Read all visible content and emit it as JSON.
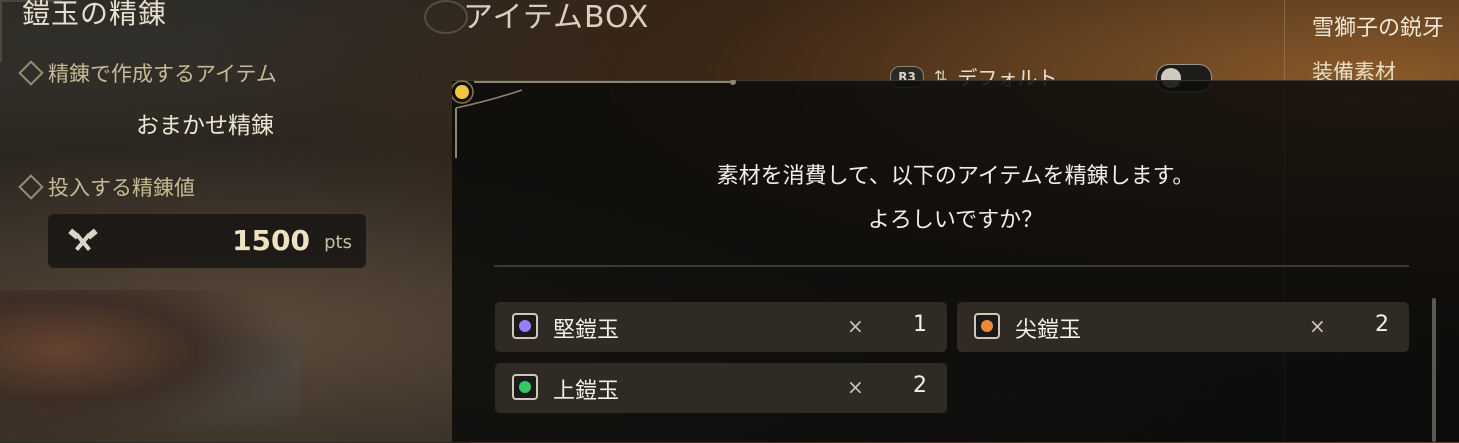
{
  "left_panel": {
    "title": "鎧玉の精錬",
    "craft_label": "精錬で作成するアイテム",
    "craft_value": "おまかせ精錬",
    "points_label": "投入する精錬値",
    "points_value": "1500",
    "points_unit": "pts"
  },
  "item_box": {
    "title": "アイテムBOX",
    "sort_button": "R3",
    "sort_label": "デフォルト",
    "sort_toggle_on": false
  },
  "right_panel": {
    "title": "雪獅子の鋭牙",
    "subtitle": "装備素材"
  },
  "dialog": {
    "message_line1": "素材を消費して、以下のアイテムを精錬します。",
    "message_line2": "よろしいですか？",
    "x_symbol": "×",
    "materials": [
      {
        "name": "堅鎧玉",
        "qty": "1",
        "color": "#9b7cff"
      },
      {
        "name": "尖鎧玉",
        "qty": "2",
        "color": "#f08a3a"
      },
      {
        "name": "上鎧玉",
        "qty": "2",
        "color": "#35c864"
      }
    ]
  }
}
